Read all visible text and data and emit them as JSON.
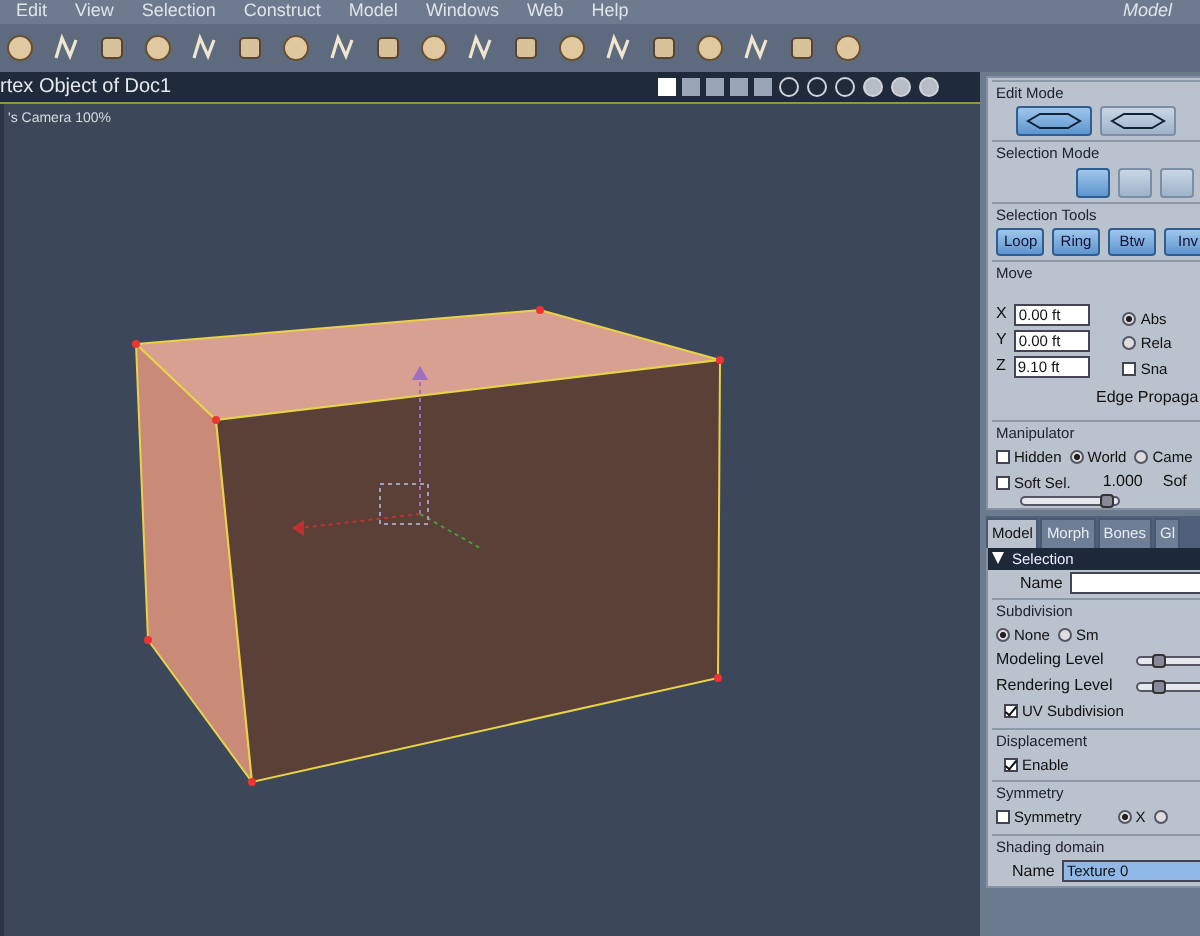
{
  "menu": [
    "Edit",
    "View",
    "Selection",
    "Construct",
    "Model",
    "Windows",
    "Web",
    "Help"
  ],
  "room_title": "Model",
  "viewport": {
    "title": "rtex Object of Doc1",
    "camera": "'s Camera 100%"
  },
  "edit_mode": {
    "title": "Edit Mode",
    "modes": [
      {
        "selected": true
      },
      {
        "selected": false
      }
    ]
  },
  "selection_mode": {
    "title": "Selection Mode",
    "modes": [
      {
        "selected": true
      },
      {
        "selected": false
      },
      {
        "selected": false
      }
    ]
  },
  "selection_tools": {
    "title": "Selection Tools",
    "buttons": [
      "Loop",
      "Ring",
      "Btw",
      "Inv"
    ]
  },
  "move": {
    "title": "Move",
    "fields": [
      {
        "label": "X",
        "value": "0.00 ft"
      },
      {
        "label": "Y",
        "value": "0.00 ft"
      },
      {
        "label": "Z",
        "value": "9.10 ft"
      }
    ],
    "options": [
      {
        "kind": "radio",
        "label": "Abs",
        "checked": true
      },
      {
        "kind": "radio",
        "label": "Rela",
        "checked": false
      },
      {
        "kind": "checkbox",
        "label": "Sna",
        "checked": false
      }
    ],
    "footer": "Edge Propaga"
  },
  "manipulator": {
    "title": "Manipulator",
    "options": [
      {
        "kind": "checkbox",
        "label": "Hidden",
        "checked": false
      },
      {
        "kind": "radio",
        "label": "World",
        "checked": true
      },
      {
        "kind": "radio",
        "label": "Came",
        "checked": false
      }
    ],
    "soft_selection": {
      "label": "Soft Sel.",
      "checked": false,
      "value": "1.000",
      "label_2": "Sof",
      "level": 0.9
    }
  },
  "tabs": [
    {
      "label": "Model",
      "selected": true
    },
    {
      "label": "Morph",
      "selected": false
    },
    {
      "label": "Bones",
      "selected": false
    },
    {
      "label": "Gl",
      "selected": false
    }
  ],
  "section": {
    "title": "Selection",
    "expanded": true,
    "name_label": "Name"
  },
  "subdivision": {
    "title": "Subdivision",
    "options": [
      {
        "label": "None",
        "checked": true
      },
      {
        "label": "Sm",
        "checked": false
      }
    ],
    "levels": [
      {
        "label": "Modeling Level",
        "level": 0.3
      },
      {
        "label": "Rendering Level",
        "level": 0.3
      }
    ],
    "uv": {
      "label": "UV Subdivision",
      "checked": true
    }
  },
  "displacement": {
    "title": "Displacement",
    "enable": {
      "label": "Enable",
      "checked": true
    }
  },
  "symmetry": {
    "title": "Symmetry",
    "checkbox": {
      "label": "Symmetry",
      "checked": false
    },
    "axes": [
      {
        "label": "X",
        "selected": true
      },
      {
        "selected": false
      }
    ]
  },
  "shading_domain": {
    "title": "Shading domain",
    "name_label": "Name",
    "value": "Texture 0"
  }
}
